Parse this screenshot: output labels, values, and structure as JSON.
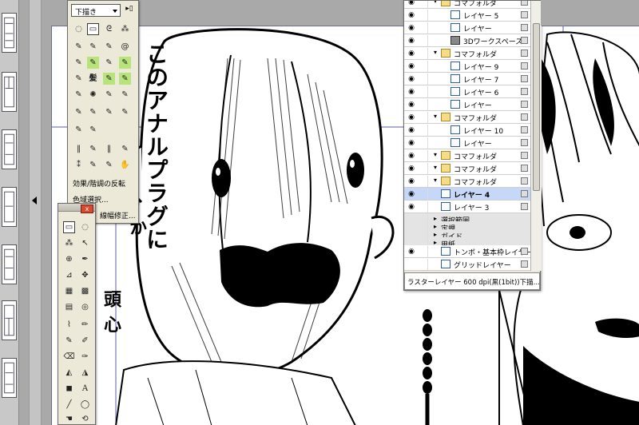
{
  "brush_palette": {
    "preset_select": "下描き",
    "menu_items": [
      "効果/階調の反転",
      "色域選択...",
      "線幅修正..."
    ]
  },
  "manga_text": {
    "speech_main": "このアナルプラグに",
    "speech_left_partial": "か",
    "speech_lower_partial": "頭 心"
  },
  "layers": [
    {
      "name": "コマフォルダ",
      "type": "folder",
      "indent": 0,
      "visible": true
    },
    {
      "name": "レイヤー 5",
      "type": "raster",
      "indent": 1,
      "visible": true
    },
    {
      "name": "レイヤー",
      "type": "raster",
      "indent": 1,
      "visible": true
    },
    {
      "name": "3Dワークスペース",
      "type": "3d",
      "indent": 1,
      "visible": true
    },
    {
      "name": "コマフォルダ",
      "type": "folder",
      "indent": 0,
      "visible": true
    },
    {
      "name": "レイヤー 9",
      "type": "raster",
      "indent": 1,
      "visible": true
    },
    {
      "name": "レイヤー 7",
      "type": "raster",
      "indent": 1,
      "visible": true
    },
    {
      "name": "レイヤー 6",
      "type": "raster",
      "indent": 1,
      "visible": true
    },
    {
      "name": "レイヤー",
      "type": "raster",
      "indent": 1,
      "visible": true
    },
    {
      "name": "コマフォルダ",
      "type": "folder",
      "indent": 0,
      "visible": true
    },
    {
      "name": "レイヤー 10",
      "type": "raster",
      "indent": 1,
      "visible": true
    },
    {
      "name": "レイヤー",
      "type": "raster",
      "indent": 1,
      "visible": true
    },
    {
      "name": "コマフォルダ",
      "type": "folder",
      "indent": 0,
      "visible": true
    },
    {
      "name": "コマフォルダ",
      "type": "folder",
      "indent": 0,
      "visible": true
    },
    {
      "name": "コマフォルダ",
      "type": "folder",
      "indent": 0,
      "visible": true
    },
    {
      "name": "レイヤー 4",
      "type": "raster",
      "indent": 0,
      "visible": true,
      "selected": true
    },
    {
      "name": "レイヤー 3",
      "type": "raster",
      "indent": 0,
      "visible": true
    },
    {
      "name": "選択範囲",
      "type": "group",
      "indent": 0,
      "visible": false
    },
    {
      "name": "定規",
      "type": "group",
      "indent": 0,
      "visible": false
    },
    {
      "name": "ガイド",
      "type": "group",
      "indent": 0,
      "visible": false
    },
    {
      "name": "用紙",
      "type": "group",
      "indent": 0,
      "visible": false
    },
    {
      "name": "トンボ・基本枠レイヤー",
      "type": "raster",
      "indent": 0,
      "visible": true
    },
    {
      "name": "グリッドレイヤー",
      "type": "raster",
      "indent": 0,
      "visible": false
    }
  ],
  "layer_status": "ラスターレイヤー 600 dpi(黒(1bit))下描...",
  "tools_palette": {
    "close_label": "x"
  },
  "colors": {
    "workspace_gray": "#a9a9a9",
    "palette_bg": "#ece9d8",
    "selected_layer": "#c7d7f7",
    "close_red": "#d9492f",
    "accent_green": "#b7e37a"
  }
}
